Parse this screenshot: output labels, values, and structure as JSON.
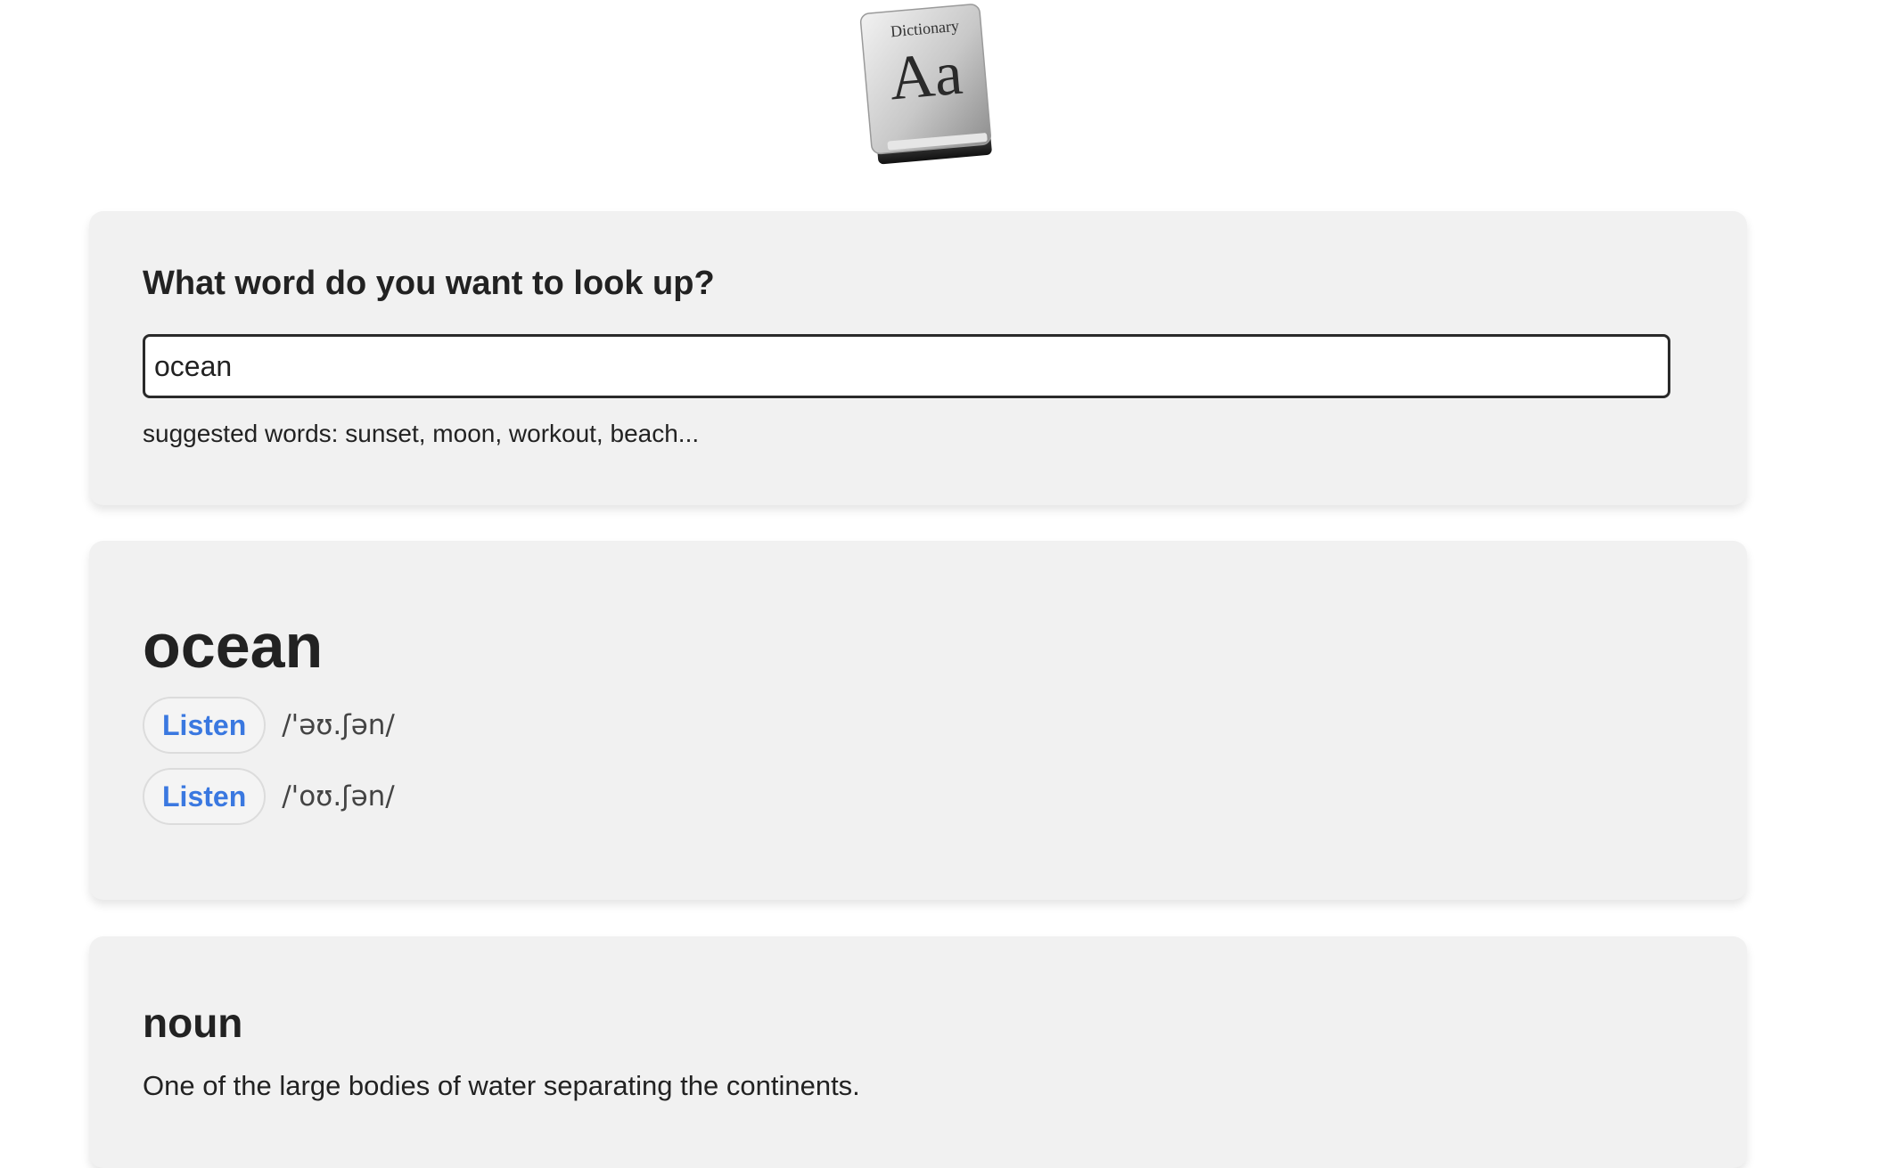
{
  "logo": {
    "label": "Dictionary",
    "glyph": "Aa",
    "icon": "dictionary-book-icon"
  },
  "search": {
    "title": "What word do you want to look up?",
    "value": "ocean",
    "placeholder": "",
    "suggestions": "suggested words: sunset, moon, workout, beach..."
  },
  "word": {
    "title": "ocean",
    "pronunciations": [
      {
        "button_label": "Listen",
        "ipa": "/'əʊ.ʃən/"
      },
      {
        "button_label": "Listen",
        "ipa": "/'oʊ.ʃən/"
      }
    ]
  },
  "meaning": {
    "part_of_speech": "noun",
    "definition": "One of the large bodies of water separating the continents."
  },
  "colors": {
    "accent": "#3a78e0",
    "card_bg": "#f1f1f1",
    "text": "#222222"
  }
}
